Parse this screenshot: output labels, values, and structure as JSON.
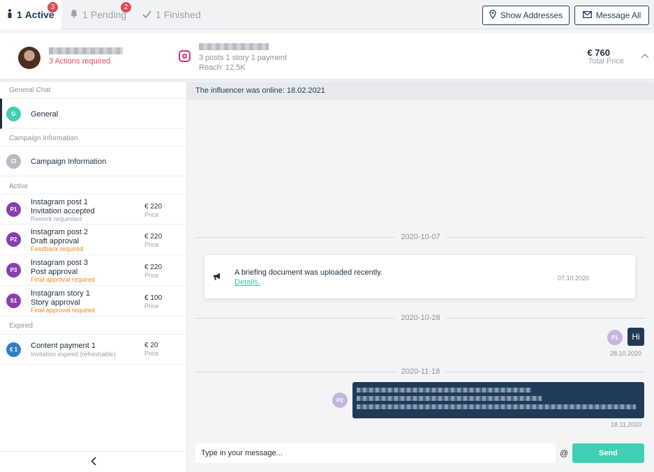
{
  "tabs": [
    {
      "count": "1",
      "label": "Active",
      "badge": "3"
    },
    {
      "count": "1",
      "label": "Pending",
      "badge": "2"
    },
    {
      "count": "1",
      "label": "Finished"
    }
  ],
  "toolbar": {
    "show_addresses": "Show Addresses",
    "message_all": "Message All"
  },
  "influencer": {
    "actions_required": "3 Actions required",
    "posts_info": "3 posts 1 story 1 payment",
    "reach": "Reach: 12,5K",
    "total_price": "€ 760",
    "total_price_label": "Total Price"
  },
  "sidebar": {
    "sections": {
      "general_chat": "General Chat",
      "campaign_information": "Campaign Information",
      "active": "Active",
      "expired": "Expired"
    },
    "general": {
      "initials": "G",
      "title": "General"
    },
    "campaign": {
      "initials": "CI",
      "title": "Campaign Information"
    },
    "active_items": [
      {
        "initials": "P1",
        "title": "Instagram post 1",
        "status": "Invitation accepted",
        "note": "Rework requested",
        "price": "€ 220",
        "price_label": "Price"
      },
      {
        "initials": "P2",
        "title": "Instagram post 2",
        "status": "Draft approval",
        "note": "Feedback required",
        "price": "€ 220",
        "price_label": "Price"
      },
      {
        "initials": "P3",
        "title": "Instagram post 3",
        "status": "Post approval",
        "note": "Final approval required",
        "price": "€ 220",
        "price_label": "Price"
      },
      {
        "initials": "S1",
        "title": "Instagram story 1",
        "status": "Story approval",
        "note": "Final approval required",
        "price": "€ 100",
        "price_label": "Price"
      }
    ],
    "expired_items": [
      {
        "initials": "€ 1",
        "title": "Content payment 1",
        "note": "Invitation expired (refreshable)",
        "price": "€ 20",
        "price_label": "Price"
      }
    ]
  },
  "chat": {
    "online_notice": "The influencer was online: 18.02.2021",
    "date_separators": [
      "2020-10-07",
      "2020-10-28",
      "2020-11-18"
    ],
    "briefing": {
      "text": "A briefing document was uploaded recently.",
      "link": "Details.",
      "date": "07.10.2020"
    },
    "messages": [
      {
        "avatar": "P1",
        "text": "Hi",
        "time": "28.10.2020"
      },
      {
        "avatar": "P2",
        "time": "18.11.2020"
      }
    ],
    "composer": {
      "placeholder": "Type in your message...",
      "at": "@",
      "send": "Send"
    }
  },
  "colors": {
    "navy": "#1f3b57",
    "teal": "#3fd0b4",
    "red_badge": "#e04a5a",
    "orange": "#f08a1c",
    "purple": "#8a3fb0",
    "instagram": "#d6307a"
  }
}
